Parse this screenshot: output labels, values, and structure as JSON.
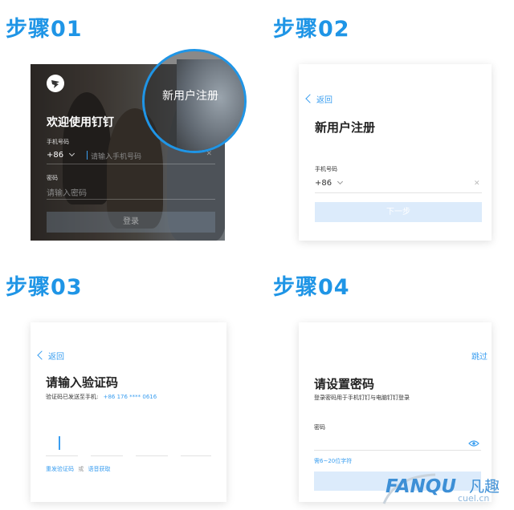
{
  "steps": [
    {
      "title": "步骤01"
    },
    {
      "title": "步骤02"
    },
    {
      "title": "步骤03"
    },
    {
      "title": "步骤04"
    }
  ],
  "step1": {
    "welcome": "欢迎使用钉钉",
    "phone_label": "手机号码",
    "country_code": "+86",
    "phone_placeholder": "请输入手机号码",
    "password_label": "密码",
    "password_placeholder": "请输入密码",
    "login_button": "登录",
    "new_user_register": "新用户注册"
  },
  "step2": {
    "back": "返回",
    "title": "新用户注册",
    "phone_label": "手机号码",
    "country_code": "+86",
    "next_button": "下一步"
  },
  "step3": {
    "back": "返回",
    "title": "请输入验证码",
    "sent_text": "验证码已发送至手机:",
    "phone_number": "+86 176 **** 0616",
    "resend": "重发验证码",
    "or": "或",
    "voice": "语音获取"
  },
  "step4": {
    "skip": "跳过",
    "title": "请设置密码",
    "subtitle": "登录密码用于手机钉钉与电脑钉钉登录",
    "password_label": "密码",
    "hint": "需6~20位字符"
  },
  "watermark": {
    "brand": "FANQU",
    "chinese": "凡趣",
    "domain": "cuel.cn"
  },
  "colors": {
    "accent": "#1f95e6",
    "button_disabled": "#dcebfb"
  }
}
